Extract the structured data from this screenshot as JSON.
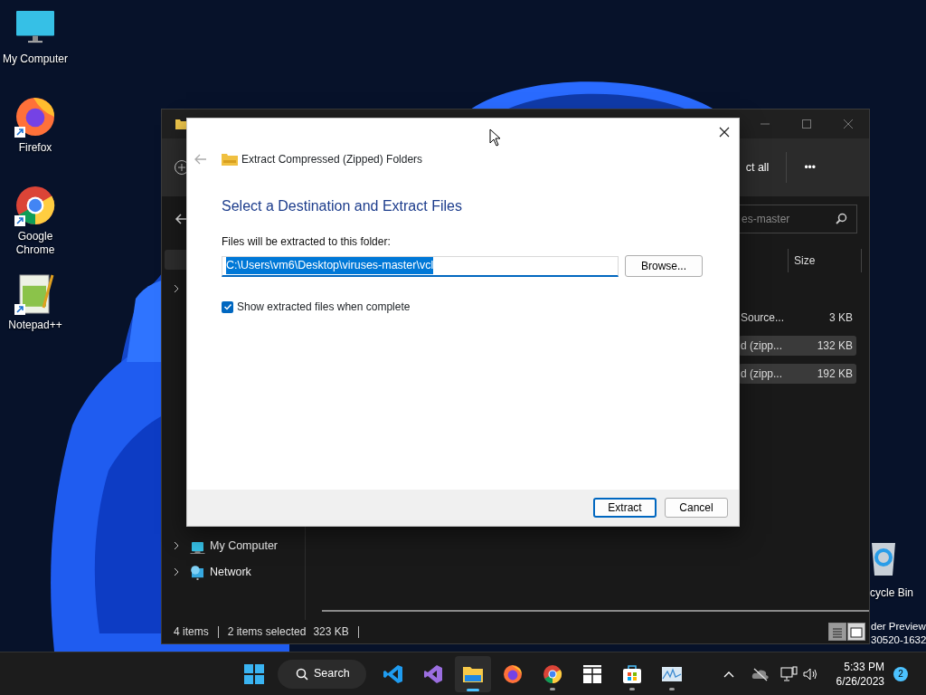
{
  "desktop_icons": [
    {
      "kind": "computer",
      "label": "My Computer",
      "shortcut": false
    },
    {
      "kind": "firefox",
      "label": "Firefox",
      "shortcut": true
    },
    {
      "kind": "chrome",
      "label": "Google Chrome",
      "shortcut": true
    },
    {
      "kind": "notepad",
      "label": "Notepad++",
      "shortcut": true
    }
  ],
  "recycle_bin": {
    "label": "cycle Bin"
  },
  "build_info": [
    "der Preview",
    "30520-1632"
  ],
  "explorer": {
    "toolbar_button": "ct all",
    "more": "•••",
    "search_placeholder": "es-master",
    "column_header": "Size",
    "rows": [
      {
        "type": "Source...",
        "size": "3 KB",
        "selected": false
      },
      {
        "type": "d (zipp...",
        "size": "132 KB",
        "selected": true
      },
      {
        "type": "d (zipp...",
        "size": "192 KB",
        "selected": true
      }
    ],
    "nav_items": [
      {
        "kind": "computer",
        "label": "My Computer"
      },
      {
        "kind": "network",
        "label": "Network"
      }
    ],
    "status": {
      "count": "4 items",
      "selection": "2 items selected",
      "size": "323 KB"
    },
    "view_buttons": [
      {
        "kind": "details",
        "selected": true
      },
      {
        "kind": "tiles",
        "selected": false
      }
    ]
  },
  "dialog": {
    "title": "Extract Compressed (Zipped) Folders",
    "heading": "Select a Destination and Extract Files",
    "field_label": "Files will be extracted to this folder:",
    "path": "C:\\Users\\vm6\\Desktop\\viruses-master\\vcl",
    "path_selected": true,
    "browse": "Browse...",
    "show_files": {
      "label": "Show extracted files when complete",
      "checked": true
    },
    "buttons": [
      {
        "label": "Extract",
        "default": true
      },
      {
        "label": "Cancel",
        "default": false
      }
    ]
  },
  "taskbar": {
    "search": "Search",
    "apps": [
      {
        "kind": "vscode",
        "selected": false,
        "running": false
      },
      {
        "kind": "visualstudio",
        "selected": false,
        "running": false
      },
      {
        "kind": "explorer",
        "selected": true,
        "running": true
      },
      {
        "kind": "firefox",
        "selected": false,
        "running": false
      },
      {
        "kind": "chrome",
        "selected": false,
        "running": true
      },
      {
        "kind": "layout",
        "selected": false,
        "running": false
      },
      {
        "kind": "store",
        "selected": false,
        "running": true
      },
      {
        "kind": "monitor",
        "selected": false,
        "running": true
      }
    ],
    "time": "5:33 PM",
    "date": "6/26/2023",
    "notifications": "2"
  }
}
